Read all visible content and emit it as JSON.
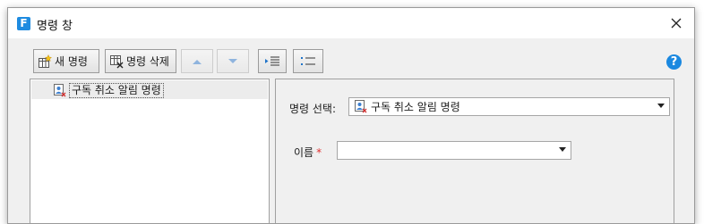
{
  "window": {
    "title": "명령 창",
    "app_icon_letter": "F"
  },
  "toolbar": {
    "new_label": "새 명령",
    "delete_label": "명령 삭제"
  },
  "tree": {
    "items": [
      {
        "label": "구독 취소 알림 명령",
        "selected": true
      }
    ]
  },
  "form": {
    "command_select_label": "명령 선택:",
    "command_select_value": "구독 취소 알림 명령",
    "name_label": "이름",
    "name_required_mark": "*",
    "name_value": ""
  },
  "colors": {
    "accent": "#1e8be0",
    "required": "#e03030",
    "window_bg": "#f0f0f0"
  },
  "icons": {
    "app": "app-logo-icon",
    "close": "close-icon",
    "new": "new-command-icon",
    "delete": "delete-command-icon",
    "up": "arrow-up-icon",
    "down": "arrow-down-icon",
    "indent": "indent-icon",
    "list": "list-icon",
    "help": "help-icon",
    "command": "command-user-icon"
  }
}
